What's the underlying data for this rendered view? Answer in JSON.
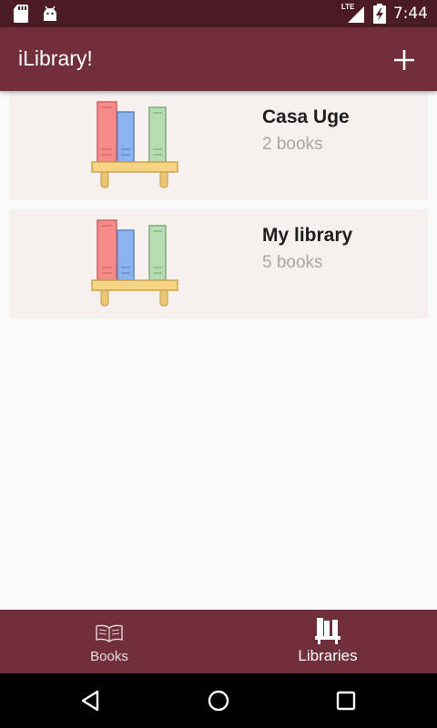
{
  "status_bar": {
    "time": "7:44",
    "network_label": "LTE",
    "icons": [
      "sd-card-icon",
      "android-icon",
      "signal-icon",
      "battery-charging-icon"
    ]
  },
  "app_bar": {
    "title": "iLibrary!",
    "add_button_icon": "plus-icon"
  },
  "libraries": [
    {
      "name": "Casa Uge",
      "count": "2 books",
      "icon": "bookshelf-icon"
    },
    {
      "name": "My library",
      "count": "5 books",
      "icon": "bookshelf-icon"
    }
  ],
  "bottom_nav": {
    "items": [
      {
        "label": "Books",
        "icon": "open-book-icon",
        "active": false
      },
      {
        "label": "Libraries",
        "icon": "library-icon",
        "active": true
      }
    ]
  },
  "system_nav": {
    "icons": [
      "back-icon",
      "home-icon",
      "recents-icon"
    ]
  },
  "colors": {
    "status_bar": "#4a1b22",
    "primary": "#702f3a",
    "card_background": "#f6f1ef",
    "page_background": "#fafafa"
  }
}
